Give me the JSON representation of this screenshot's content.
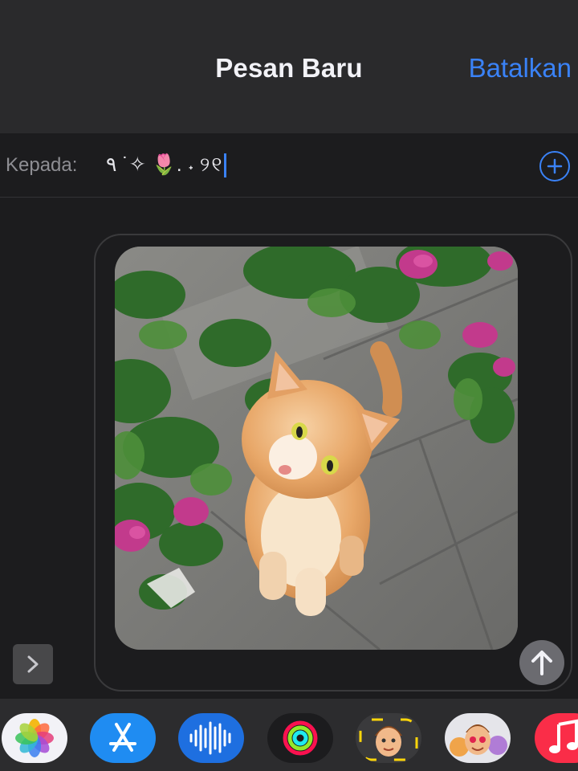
{
  "header": {
    "title": "Pesan Baru",
    "cancel_label": "Batalkan"
  },
  "to_field": {
    "label": "Kepada:",
    "value": "٩ ˙✧ 🌷. ˖ ୨୧"
  },
  "compose": {
    "attachment": "photo of an orange-and-white kitten sitting under bougainvillea flowers on stone pavement"
  },
  "app_drawer": {
    "apps": [
      "photos-icon",
      "app-store-icon",
      "audio-message-icon",
      "activity-icon",
      "memoji-icon",
      "memoji-stickers-icon",
      "music-icon"
    ]
  },
  "colors": {
    "accent": "#3a82f7",
    "background": "#1c1c1e",
    "header": "#2a2a2c"
  }
}
